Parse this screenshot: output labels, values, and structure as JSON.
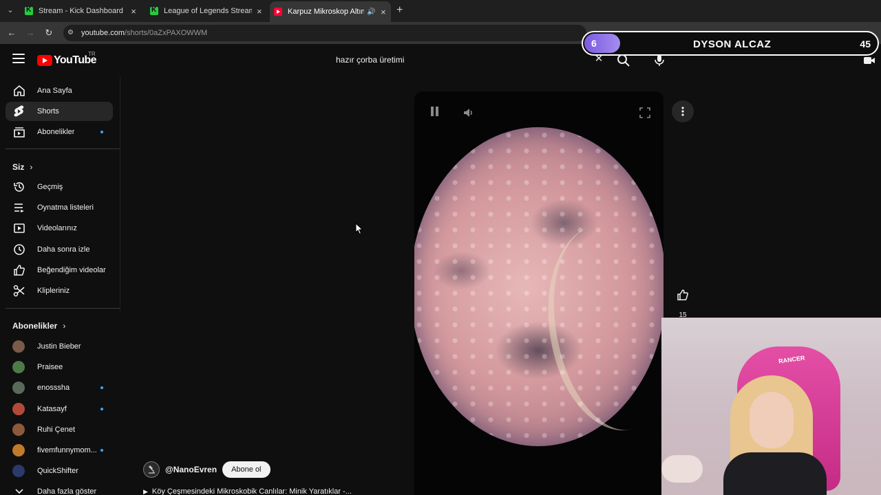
{
  "browser": {
    "tabs": [
      {
        "title": "Stream - Kick Dashboard",
        "icon": "kick-icon",
        "active": false
      },
      {
        "title": "League of Legends Streaming",
        "icon": "kick-icon",
        "active": false
      },
      {
        "title": "Karpuz Mikroskop Altında -",
        "icon": "youtube-icon",
        "active": true
      }
    ],
    "url_host": "youtube.com",
    "url_path": "/shorts/0aZxPAXOWWM"
  },
  "overlay": {
    "level": "6",
    "name": "DYSON ALCAZ",
    "count": "45"
  },
  "masthead": {
    "logo_text": "YouTube",
    "region": "TR",
    "search_value": "hazır çorba üretimi"
  },
  "sidebar": {
    "main": [
      {
        "label": "Ana Sayfa",
        "icon": "home-icon"
      },
      {
        "label": "Shorts",
        "icon": "shorts-icon"
      },
      {
        "label": "Abonelikler",
        "icon": "subscriptions-icon"
      }
    ],
    "you_header": "Siz",
    "you": [
      {
        "label": "Geçmiş",
        "icon": "history-icon"
      },
      {
        "label": "Oynatma listeleri",
        "icon": "playlists-icon"
      },
      {
        "label": "Videolarınız",
        "icon": "your-videos-icon"
      },
      {
        "label": "Daha sonra izle",
        "icon": "watch-later-icon"
      },
      {
        "label": "Beğendiğim videolar",
        "icon": "liked-icon"
      },
      {
        "label": "Klipleriniz",
        "icon": "clips-icon"
      }
    ],
    "subs_header": "Abonelikler",
    "subs": [
      {
        "label": "Justin Bieber",
        "color": "#7a5a48",
        "new": false
      },
      {
        "label": "Praisee",
        "color": "#4e7a4a",
        "new": false
      },
      {
        "label": "enosssha",
        "color": "#5a6a5a",
        "new": true
      },
      {
        "label": "Katasayf",
        "color": "#b24a3a",
        "new": true
      },
      {
        "label": "Ruhi Çenet",
        "color": "#8a5a3a",
        "new": false
      },
      {
        "label": "fivemfunnymom...",
        "color": "#c07a2a",
        "new": true
      },
      {
        "label": "QuickShifter",
        "color": "#2a3a6a",
        "new": false
      }
    ],
    "show_more": "Daha fazla göster"
  },
  "short": {
    "like_count": "15",
    "channel": "@NanoEvren",
    "subscribe_label": "Abone ol",
    "title": "Köy Çeşmesindeki Mikroskobik Canlılar: Minik Yaratıklar -..."
  },
  "webcam": {
    "chair_text": "RANCER"
  }
}
